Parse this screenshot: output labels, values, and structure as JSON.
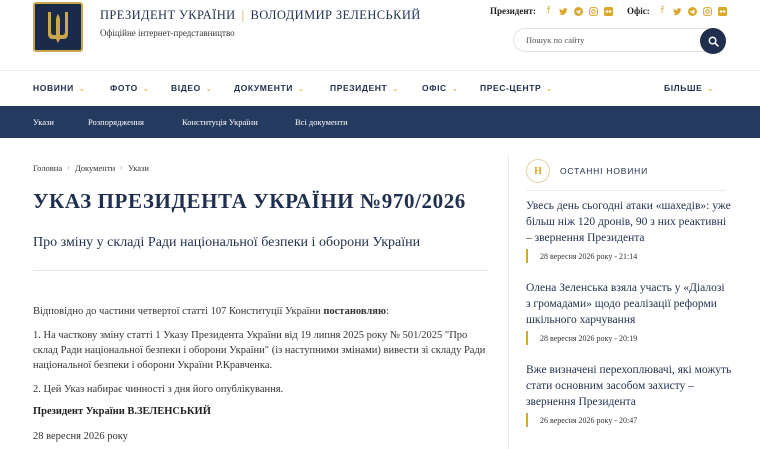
{
  "header": {
    "title_left": "ПРЕЗИДЕНТ УКРАЇНИ",
    "title_separator": "|",
    "title_right": "ВОЛОДИМИР ЗЕЛЕНСЬКИЙ",
    "subtitle": "Офіційне інтернет-представництво",
    "social_president_label": "Президент:",
    "social_office_label": "Офіс:",
    "search_placeholder": "Пошук по сайту"
  },
  "main_nav": {
    "items": [
      "НОВИНИ",
      "ФОТО",
      "ВІДЕО",
      "ДОКУМЕНТИ",
      "ПРЕЗИДЕНТ",
      "ОФІС",
      "ПРЕС-ЦЕНТР",
      "БІЛЬШЕ"
    ]
  },
  "sub_nav": {
    "items": [
      "Укази",
      "Розпорядження",
      "Конституція України",
      "Всі документи"
    ]
  },
  "breadcrumb": [
    "Головна",
    "Документи",
    "Укази"
  ],
  "document": {
    "title": "УКАЗ ПРЕЗИДЕНТА УКРАЇНИ №970/2026",
    "subtitle": "Про зміну у складі Ради національної безпеки і оборони України",
    "intro": "Відповідно до частини четвертої статті 107 Конституції України",
    "intro_bold": "постановляю",
    "intro_end": ":",
    "para1": "1. На часткову зміну статті 1 Указу Президента України від 19 липня 2025 року № 501/2025 \"Про склад Ради національної безпеки і оборони України\" (із наступними змінами) вивести зі складу Ради національної безпеки і оборони України Р.Кравченка.",
    "para2": "2. Цей Указ набирає чинності з дня його опублікування.",
    "signature": "Президент України В.ЗЕЛЕНСЬКИЙ",
    "date": "28 вересня 2026 року"
  },
  "sidebar": {
    "badge": "Н",
    "heading": "ОСТАННІ НОВИНИ",
    "news": [
      {
        "title": "Увесь день сьогодні атаки «шахедів»: уже більш ніж 120 дронів, 90 з них реактивні – звернення Президента",
        "date": "28 вересня 2026 року - 21:14"
      },
      {
        "title": "Олена Зеленська взяла участь у «Діалозі з громадами» щодо реалізації реформи шкільного харчування",
        "date": "28 вересня 2026 року - 20:19"
      },
      {
        "title": "Вже визначені перехоплювачі, які можуть стати основним засобом захисту – звернення Президента",
        "date": "26 вересня 2026 року - 20:47"
      }
    ]
  },
  "colors": {
    "navy": "#1f2f4d",
    "subnav_bg": "#243a5e",
    "accent_gold": "#d9a82b"
  }
}
